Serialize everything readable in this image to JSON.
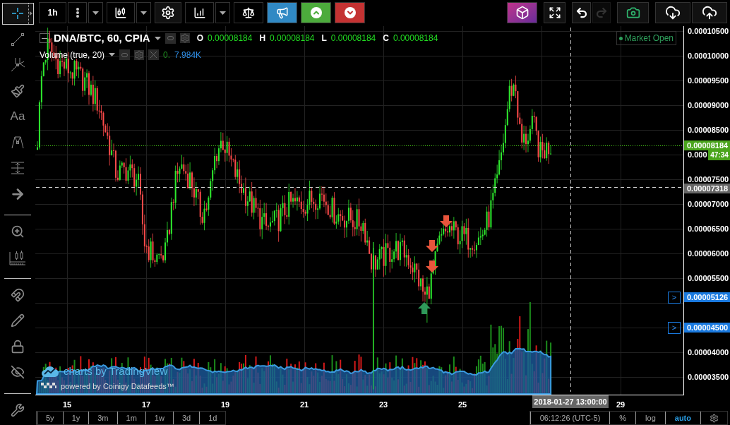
{
  "left_toolbar": {
    "groups": [
      [
        {
          "kind": "crosshair",
          "selected": true
        },
        {
          "kind": "trend-line",
          "selected": false
        },
        {
          "kind": "pitchfork",
          "selected": false
        },
        {
          "kind": "brush",
          "selected": false
        },
        {
          "kind": "text",
          "label": "Aa",
          "selected": false
        },
        {
          "kind": "pattern",
          "selected": false
        },
        {
          "kind": "measure",
          "selected": false
        },
        {
          "kind": "arrow",
          "selected": false
        }
      ],
      [
        {
          "kind": "zoom",
          "selected": false
        },
        {
          "kind": "ruler",
          "selected": false
        }
      ],
      [
        {
          "kind": "magnet",
          "selected": false
        },
        {
          "kind": "pencils",
          "selected": false
        },
        {
          "kind": "lock",
          "selected": false
        },
        {
          "kind": "hide",
          "selected": false
        }
      ],
      [
        {
          "kind": "tools",
          "selected": false
        }
      ]
    ]
  },
  "top_toolbar": {
    "left_groups": [
      [
        {
          "kind": "interval",
          "label": "1h",
          "disabled": false
        },
        {
          "kind": "more",
          "disabled": false
        },
        {
          "kind": "caret",
          "disabled": false
        }
      ],
      [
        {
          "kind": "chart-type",
          "disabled": false
        },
        {
          "kind": "caret",
          "disabled": false
        }
      ],
      [
        {
          "kind": "settings",
          "disabled": false
        }
      ],
      [
        {
          "kind": "indicators",
          "disabled": false
        },
        {
          "kind": "caret",
          "disabled": false
        }
      ],
      [
        {
          "kind": "compare",
          "disabled": false
        }
      ],
      [
        {
          "kind": "alert",
          "disabled": false
        }
      ],
      [
        {
          "kind": "buy",
          "disabled": false
        }
      ],
      [
        {
          "kind": "sell",
          "disabled": false
        }
      ]
    ],
    "right_groups": [
      [
        {
          "kind": "logo",
          "disabled": false
        }
      ],
      [
        {
          "kind": "fullscreen",
          "disabled": false
        }
      ],
      [
        {
          "kind": "undo",
          "disabled": false
        },
        {
          "kind": "redo",
          "disabled": true
        }
      ],
      [
        {
          "kind": "snapshot",
          "disabled": false
        }
      ],
      [
        {
          "kind": "load",
          "disabled": false
        },
        {
          "kind": "save",
          "disabled": false
        }
      ]
    ]
  },
  "legend": {
    "symbol": "DNA/BTC, 60, CPIA",
    "ohlc": [
      {
        "label": "O",
        "value": "0.00008184"
      },
      {
        "label": "H",
        "value": "0.00008184"
      },
      {
        "label": "L",
        "value": "0.00008184"
      },
      {
        "label": "C",
        "value": "0.00008184"
      }
    ],
    "volume": {
      "title": "Volume (true, 20)",
      "values": [
        {
          "text": "0.",
          "color": "#1f8f1f"
        },
        {
          "text": "7.984K",
          "color": "#2f8fe8"
        }
      ]
    }
  },
  "market_status": "Market Open",
  "branding": {
    "title": "charts by TradingView",
    "subtitle": "powered by Coinigy Datafeeds™"
  },
  "price_axis": {
    "ticks": [
      "0.00010500",
      "0.00010000",
      "0.00009500",
      "0.00009000",
      "0.00008500",
      "0.000",
      "0.00007500",
      "0.00007000",
      "0.00006500",
      "0.00006000",
      "0.00005500",
      "0.00004000",
      "0.00003500"
    ],
    "labels": [
      {
        "kind": "last",
        "text": "0.00008184"
      },
      {
        "kind": "countdown",
        "text": "47:34"
      },
      {
        "kind": "crosshair",
        "text": "0.00007318"
      },
      {
        "kind": "alert",
        "text": "0.00005126",
        "marker": ">"
      },
      {
        "kind": "alert",
        "text": "0.00004500",
        "marker": ">"
      }
    ]
  },
  "time_axis": {
    "ticks": [
      "15",
      "17",
      "19",
      "21",
      "23",
      "25",
      "29"
    ],
    "crosshair": "2018-01-27 13:00:00"
  },
  "bottom_bar": {
    "ranges": [
      "5y",
      "1y",
      "3m",
      "1m",
      "1w",
      "3d",
      "1d"
    ],
    "clock": "06:12:26 (UTC-5)",
    "toggles": [
      {
        "label": "%",
        "selected": false
      },
      {
        "label": "log",
        "selected": false
      },
      {
        "label": "auto",
        "selected": true
      }
    ]
  }
}
